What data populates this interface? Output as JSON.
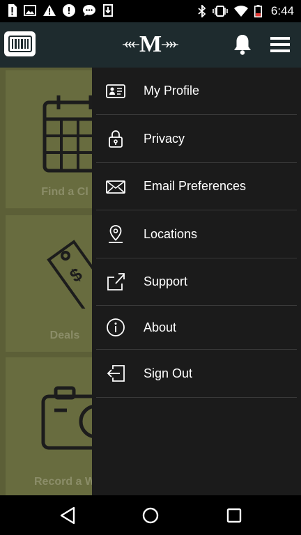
{
  "status_bar": {
    "time": "6:44",
    "left_icons": [
      "sim-alert-icon",
      "image-icon",
      "warning-icon",
      "alert-circle-icon",
      "chat-icon",
      "download-icon"
    ],
    "right_icons": [
      "bluetooth-icon",
      "vibrate-icon",
      "wifi-icon",
      "battery-low-icon"
    ]
  },
  "app_bar": {
    "logo_letter": "M",
    "icons": [
      "barcode-icon",
      "bell-icon",
      "hamburger-menu-icon"
    ]
  },
  "background_tiles": [
    {
      "label": "Find a Cl",
      "icon": "calendar-icon"
    },
    {
      "label": "Deals",
      "icon": "price-tag-icon"
    },
    {
      "label": "Record a W",
      "icon": "camera-icon"
    }
  ],
  "drawer": {
    "items": [
      {
        "label": "My Profile",
        "icon": "id-card-icon"
      },
      {
        "label": "Privacy",
        "icon": "lock-icon"
      },
      {
        "label": "Email Preferences",
        "icon": "envelope-icon"
      },
      {
        "label": "Locations",
        "icon": "location-pin-icon"
      },
      {
        "label": "Support",
        "icon": "external-link-icon"
      },
      {
        "label": "About",
        "icon": "info-icon"
      },
      {
        "label": "Sign Out",
        "icon": "sign-out-icon"
      }
    ]
  },
  "nav_bar": {
    "icons": [
      "back-icon",
      "home-icon",
      "recents-icon"
    ]
  },
  "colors": {
    "app_bar": "#1e2b2e",
    "drawer": "#1b1b1b",
    "content_background": "#5c5f37",
    "tile": "#686c3f"
  }
}
